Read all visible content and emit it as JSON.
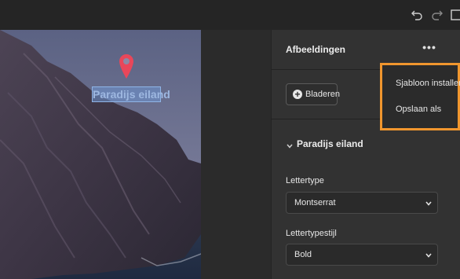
{
  "toolbar": {
    "icons": [
      "undo-icon",
      "redo-icon",
      "layout-icon"
    ]
  },
  "canvas": {
    "map_label": "Paradijs eiland"
  },
  "panel": {
    "title": "Afbeeldingen",
    "more_label": "•••",
    "browse_label": "Bladeren",
    "section_title": "Paradijs eiland",
    "font_label": "Lettertype",
    "font_value": "Montserrat",
    "style_label": "Lettertypestijl",
    "style_value": "Bold"
  },
  "menu": {
    "items": [
      "Sjabloon installeren",
      "Opslaan als"
    ]
  },
  "colors": {
    "highlight_border": "#f0962e",
    "pin": "#e8475a"
  }
}
